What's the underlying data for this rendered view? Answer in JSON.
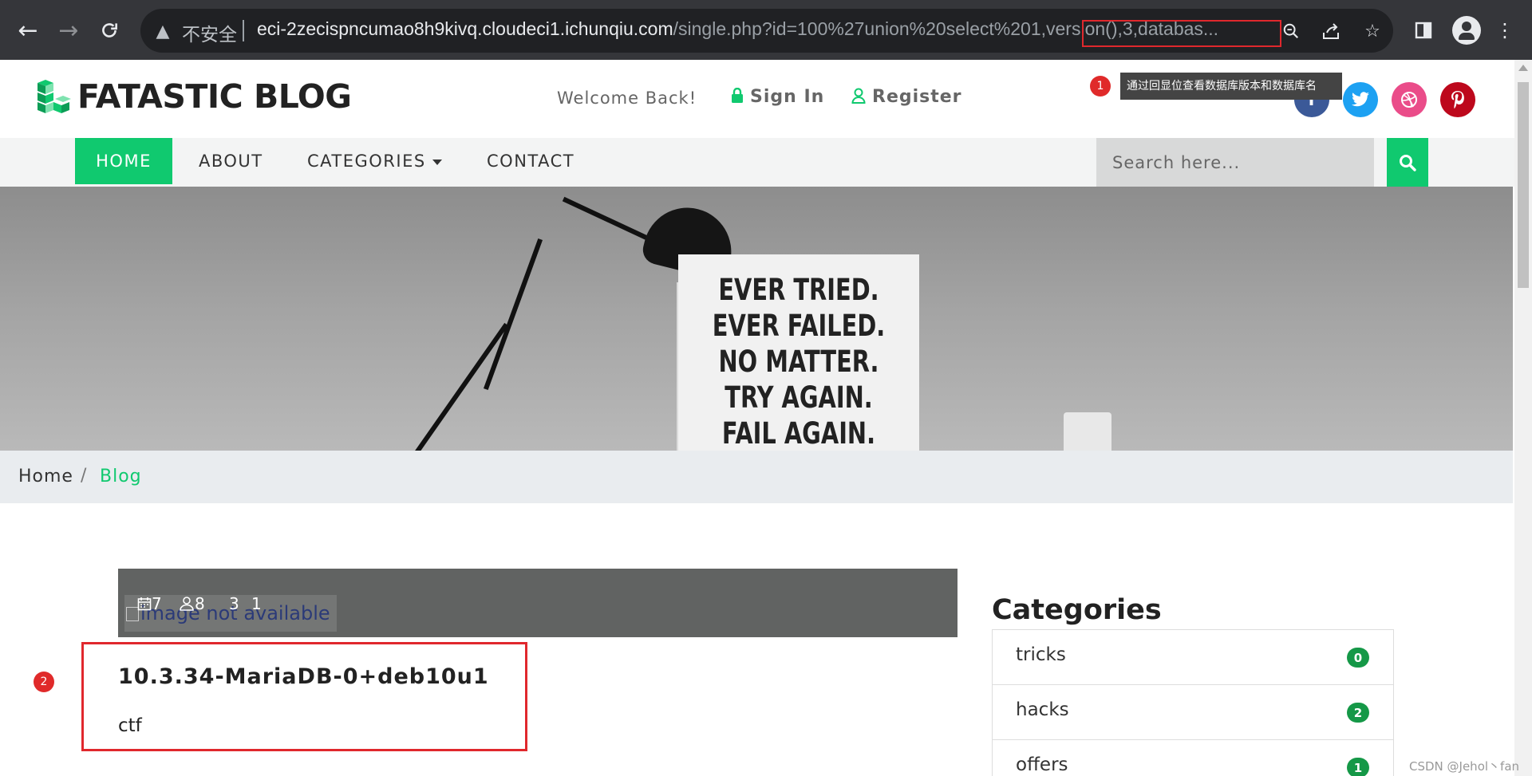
{
  "browser": {
    "insecure_label": "不安全",
    "url_host": "eci-2zecispncumao8h9kivq.cloudeci1.ichunqiu.com",
    "url_path": "/single.php?id=100%27union%20select%201,version(),3,databas..."
  },
  "header": {
    "logo": "FATASTIC BLOG",
    "welcome": "Welcome Back!",
    "signin": "Sign In",
    "register": "Register",
    "social": [
      "facebook-icon",
      "twitter-icon",
      "dribbble-icon",
      "pinterest-icon"
    ],
    "tooltip": "通过回显位查看数据库版本和数据库名"
  },
  "markers": [
    "1",
    "2"
  ],
  "nav": {
    "items": [
      "HOME",
      "ABOUT",
      "CATEGORIES",
      "CONTACT"
    ],
    "search_placeholder": "Search here..."
  },
  "hero": {
    "poster_lines": [
      "EVER TRIED.",
      "EVER FAILED.",
      "NO MATTER.",
      "TRY AGAIN.",
      "FAIL AGAIN."
    ]
  },
  "breadcrumb": {
    "home": "Home",
    "separator": "/",
    "current": "Blog"
  },
  "post": {
    "meta": [
      "7",
      "8",
      "3",
      "1"
    ],
    "image_alt": "image not available",
    "title": "10.3.34-MariaDB-0+deb10u1",
    "excerpt": "ctf"
  },
  "sidebar": {
    "heading": "Categories",
    "categories": [
      {
        "name": "tricks",
        "count": "0"
      },
      {
        "name": "hacks",
        "count": "2"
      },
      {
        "name": "offers",
        "count": "1"
      }
    ]
  },
  "watermark": "CSDN @Jehol丶fan",
  "colors": {
    "accent": "#10c96f",
    "highlight": "#e0282d",
    "facebook": "#3b5998",
    "twitter": "#1da1f2",
    "dribbble": "#ea4c89",
    "pinterest": "#bd081c"
  }
}
